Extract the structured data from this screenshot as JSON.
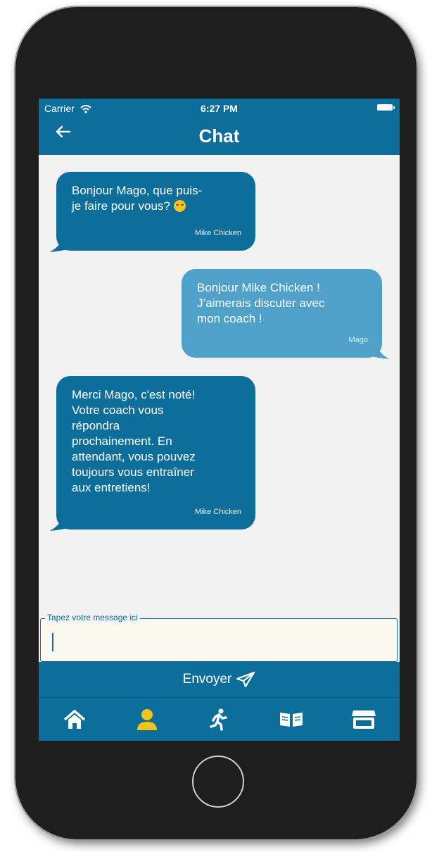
{
  "status_bar": {
    "carrier": "Carrier",
    "time": "6:27 PM"
  },
  "header": {
    "title": "Chat",
    "back_icon": "arrow-left-icon"
  },
  "messages": [
    {
      "direction": "incoming",
      "text": "Bonjour Mago, que puis-\nje faire pour vous? ",
      "emoji": "smiling-face-icon",
      "sender": "Mike Chicken"
    },
    {
      "direction": "outgoing",
      "text": "Bonjour Mike Chicken !\nJ’aimerais discuter avec\nmon coach !",
      "sender": "Mago"
    },
    {
      "direction": "incoming",
      "text": "Merci Mago, c'est noté!\nVotre coach vous\nrépondra\nprochainement. En\nattendant, vous pouvez\ntoujours vous entraîner\naux entretiens!",
      "sender": "Mike Chicken"
    }
  ],
  "composer": {
    "label": "Tapez votre message ici",
    "value": "",
    "send_label": "Envoyer",
    "send_icon": "paper-plane-icon"
  },
  "tabs": [
    {
      "name": "home",
      "icon": "home-icon",
      "active": false
    },
    {
      "name": "profile",
      "icon": "user-icon",
      "active": true
    },
    {
      "name": "training",
      "icon": "running-icon",
      "active": false
    },
    {
      "name": "library",
      "icon": "book-open-icon",
      "active": false
    },
    {
      "name": "store",
      "icon": "store-icon",
      "active": false
    }
  ],
  "colors": {
    "primary": "#0d6e9c",
    "outgoing_bubble": "#4fa1c9",
    "background": "#f2f2f2",
    "active_tab": "#f2c318",
    "tab_icon": "#ffffff"
  }
}
